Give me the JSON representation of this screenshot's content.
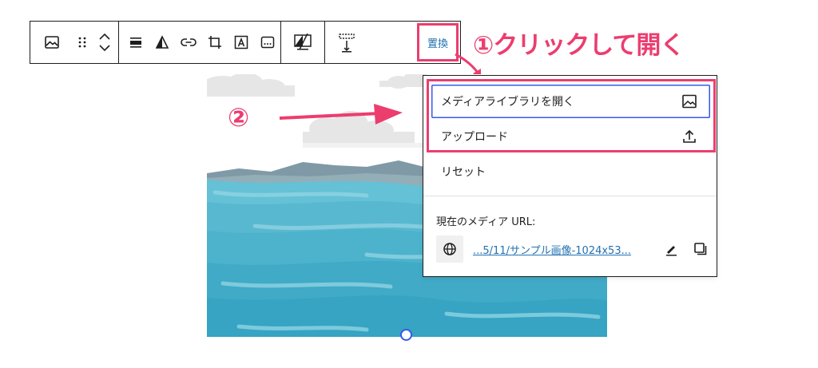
{
  "toolbar": {
    "items": [
      {
        "icon": "image-icon",
        "label": ""
      },
      {
        "icon": "drag-handle-icon",
        "label": ""
      },
      {
        "icon": "move-up-icon",
        "label": ""
      },
      {
        "icon": "move-down-icon",
        "label": ""
      },
      {
        "icon": "align-icon",
        "label": ""
      },
      {
        "icon": "duotone-icon",
        "label": ""
      },
      {
        "icon": "link-icon",
        "label": ""
      },
      {
        "icon": "crop-icon",
        "label": ""
      },
      {
        "icon": "text-overlay-icon",
        "label": ""
      },
      {
        "icon": "more-options-icon",
        "label": ""
      },
      {
        "icon": "alt-text-icon",
        "label": ""
      },
      {
        "icon": "resize-height-icon",
        "label": ""
      }
    ],
    "replace_label": "置換"
  },
  "annotations": {
    "step1": "①クリックして開く",
    "step2": "②"
  },
  "menu": {
    "open_library": "メディアライブラリを開く",
    "upload": "アップロード",
    "reset": "リセット",
    "current_url_label": "現在のメディア URL:",
    "url_text": "...5/11/サンプル画像-1024x53..."
  },
  "colors": {
    "annotation": "#ec3d6f",
    "link": "#2271b1",
    "focus": "#3858e9",
    "sea": "#3aadc9",
    "mountain": "#7f9aa6"
  }
}
